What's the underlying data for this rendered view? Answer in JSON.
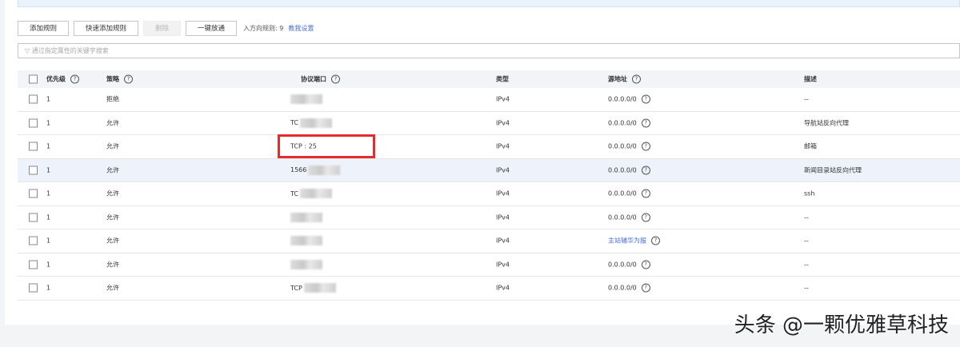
{
  "toolbar": {
    "add_rule": "添加规则",
    "quick_add_rule": "快速添加规则",
    "delete": "删除",
    "one_click_open": "一键放通",
    "inbound_count_label": "入方向规则: 9",
    "help_link": "教我设置"
  },
  "search": {
    "placeholder": "通过指定属性的关键字搜索"
  },
  "table": {
    "headers": {
      "priority": "优先级",
      "policy": "策略",
      "protocol_port": "协议端口",
      "type": "类型",
      "source": "源地址",
      "description": "描述"
    },
    "rows": [
      {
        "priority": "1",
        "policy": "拒绝",
        "port": "",
        "type": "IPv4",
        "source": "0.0.0.0/0",
        "source_link": false,
        "description": "--"
      },
      {
        "priority": "1",
        "policy": "允许",
        "port": "TC",
        "type": "IPv4",
        "source": "0.0.0.0/0",
        "source_link": false,
        "description": "导航站反向代理"
      },
      {
        "priority": "1",
        "policy": "允许",
        "port": "TCP : 25",
        "type": "IPv4",
        "source": "0.0.0.0/0",
        "source_link": false,
        "description": "邮箱"
      },
      {
        "priority": "1",
        "policy": "允许",
        "port": "1566",
        "type": "IPv4",
        "source": "0.0.0.0/0",
        "source_link": false,
        "description": "新闻目录站反向代理"
      },
      {
        "priority": "1",
        "policy": "允许",
        "port": "TC",
        "type": "IPv4",
        "source": "0.0.0.0/0",
        "source_link": false,
        "description": "ssh"
      },
      {
        "priority": "1",
        "policy": "允许",
        "port": "",
        "type": "IPv4",
        "source": "0.0.0.0/0",
        "source_link": false,
        "description": "--"
      },
      {
        "priority": "1",
        "policy": "允许",
        "port": "",
        "type": "IPv4",
        "source": "主站辅华为服",
        "source_link": true,
        "description": "--"
      },
      {
        "priority": "1",
        "policy": "允许",
        "port": "",
        "type": "IPv4",
        "source": "0.0.0.0/0",
        "source_link": false,
        "description": "--"
      },
      {
        "priority": "1",
        "policy": "允许",
        "port": "TCP",
        "type": "IPv4",
        "source": "0.0.0.0/0",
        "source_link": false,
        "description": "--"
      }
    ]
  },
  "watermark": "头条 @一颗优雅草科技"
}
